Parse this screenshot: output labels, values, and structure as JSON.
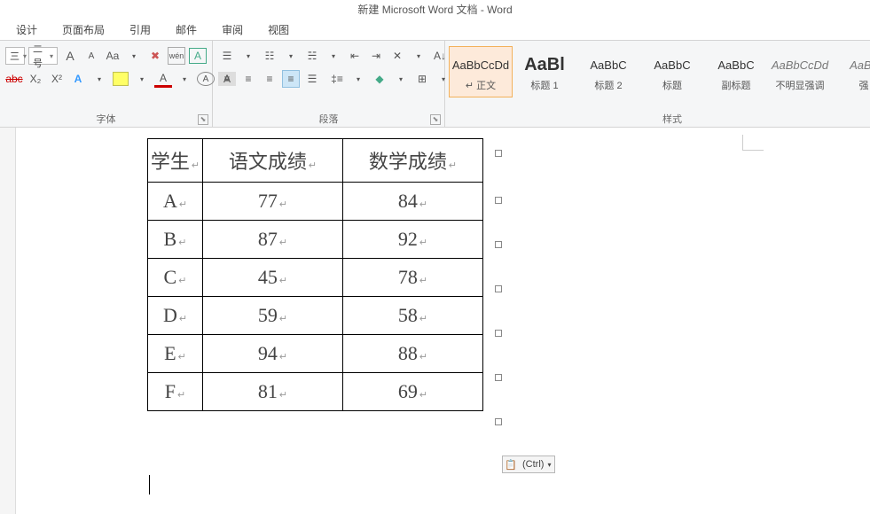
{
  "window": {
    "title": "新建 Microsoft Word 文档 - Word"
  },
  "menu": {
    "items": [
      "设计",
      "页面布局",
      "引用",
      "邮件",
      "审阅",
      "视图"
    ]
  },
  "font": {
    "size_sel": "二号",
    "grow": "A",
    "shrink": "A",
    "case": "Aa",
    "clear": "✖",
    "phonetic": "wén",
    "charborder": "A",
    "strike": "abc",
    "sub": "X₂",
    "sup": "X²",
    "texteffect": "A",
    "highlight": "ab",
    "fontcolor": "A",
    "circle": "A",
    "shade": "A",
    "label": "字体"
  },
  "para": {
    "bullets": "•",
    "numbers": "1",
    "multi": "≡",
    "dec": "◀",
    "inc": "▶",
    "sort": "A↓",
    "showmarks": "¶",
    "al": "≡",
    "ac": "≡",
    "ar": "≡",
    "aj": "≡",
    "dist": "≡",
    "linespace": "↕",
    "fill": "▢",
    "border": "▢",
    "label": "段落"
  },
  "styles": {
    "items": [
      {
        "preview": "AaBbCcDd",
        "name": "↵ 正文",
        "sel": true,
        "cls": ""
      },
      {
        "preview": "AaBl",
        "name": "标题 1",
        "cls": "big"
      },
      {
        "preview": "AaBbC",
        "name": "标题 2",
        "cls": ""
      },
      {
        "preview": "AaBbC",
        "name": "标题",
        "cls": ""
      },
      {
        "preview": "AaBbC",
        "name": "副标题",
        "cls": ""
      },
      {
        "preview": "AaBbCcDd",
        "name": "不明显强调",
        "cls": "ital"
      },
      {
        "preview": "AaBb",
        "name": "强",
        "cls": "ital"
      }
    ],
    "label": "样式"
  },
  "table": {
    "headers": [
      "学生",
      "语文成绩",
      "数学成绩"
    ],
    "rows": [
      [
        "A",
        "77",
        "84"
      ],
      [
        "B",
        "87",
        "92"
      ],
      [
        "C",
        "45",
        "78"
      ],
      [
        "D",
        "59",
        "58"
      ],
      [
        "E",
        "94",
        "88"
      ],
      [
        "F",
        "81",
        "69"
      ]
    ]
  },
  "paste_options": {
    "label": "(Ctrl)"
  }
}
